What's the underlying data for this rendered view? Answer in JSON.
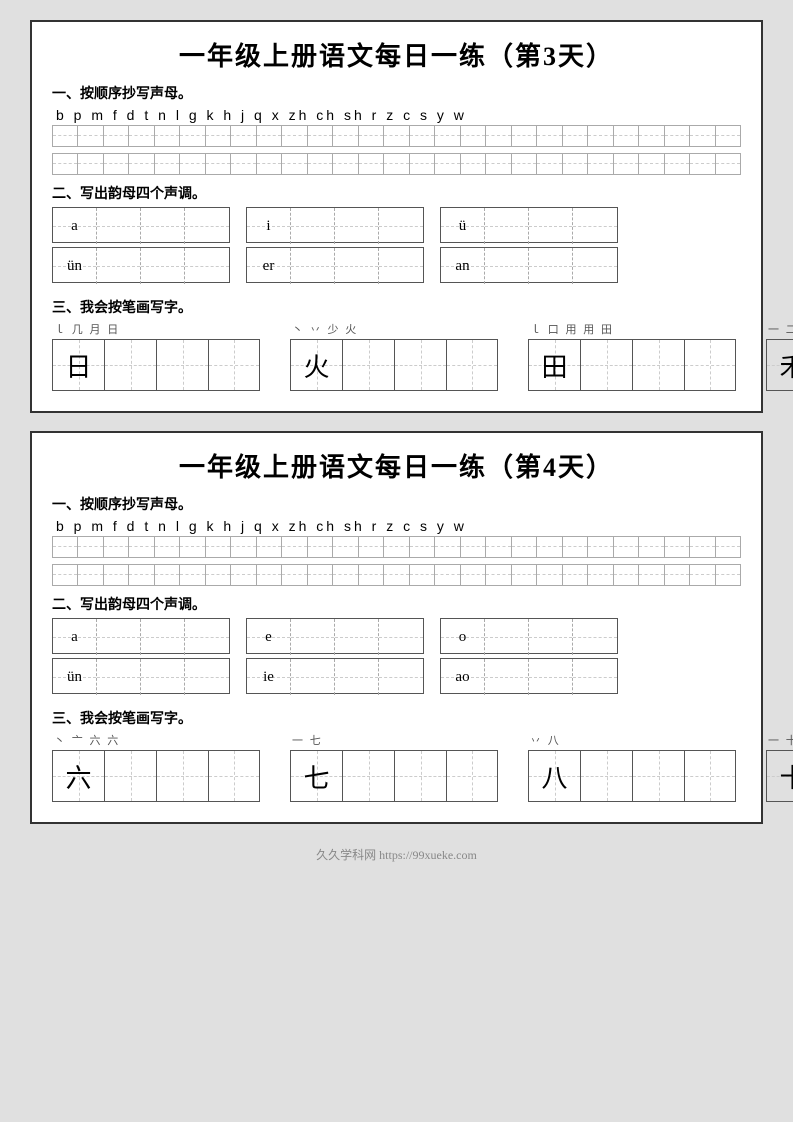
{
  "worksheet1": {
    "title": "一年级上册语文每日一练（第3天）",
    "section1_label": "一、按顺序抄写声母。",
    "pinyin": "b  p  m  f  d  t  n  l  g  k  h  j  q  x zh ch sh  r  z  c  s  y  w",
    "section2_label": "二、写出韵母四个声调。",
    "tone_groups_row1": [
      "a",
      "i",
      "ü"
    ],
    "tone_groups_row2": [
      "ün",
      "er",
      "an"
    ],
    "section3_label": "三、我会按笔画写字。",
    "char_groups": [
      {
        "hint": "ｌ 几 月 日",
        "char": "日"
      },
      {
        "hint": "丶 丷 少 火",
        "char": "火"
      },
      {
        "hint": "ｌ 口 用 用 田",
        "char": "田"
      },
      {
        "hint": "一 二 千 才 禾",
        "char": "禾"
      }
    ]
  },
  "worksheet2": {
    "title": "一年级上册语文每日一练（第4天）",
    "section1_label": "一、按顺序抄写声母。",
    "pinyin": "b  p  m  f  d  t  n  l  g  k  h  j  q  x zh ch sh  r  z  c  s  y  w",
    "section2_label": "二、写出韵母四个声调。",
    "tone_groups_row1": [
      "a",
      "e",
      "o"
    ],
    "tone_groups_row2": [
      "ün",
      "ie",
      "ao"
    ],
    "section3_label": "三、我会按笔画写字。",
    "char_groups": [
      {
        "hint": "丶 亠 六 六",
        "char": "六"
      },
      {
        "hint": "一 七",
        "char": "七"
      },
      {
        "hint": "丷 八",
        "char": "八"
      },
      {
        "hint": "一 十",
        "char": "十"
      }
    ]
  },
  "footer": "久久学科网 https://99xueke.com"
}
